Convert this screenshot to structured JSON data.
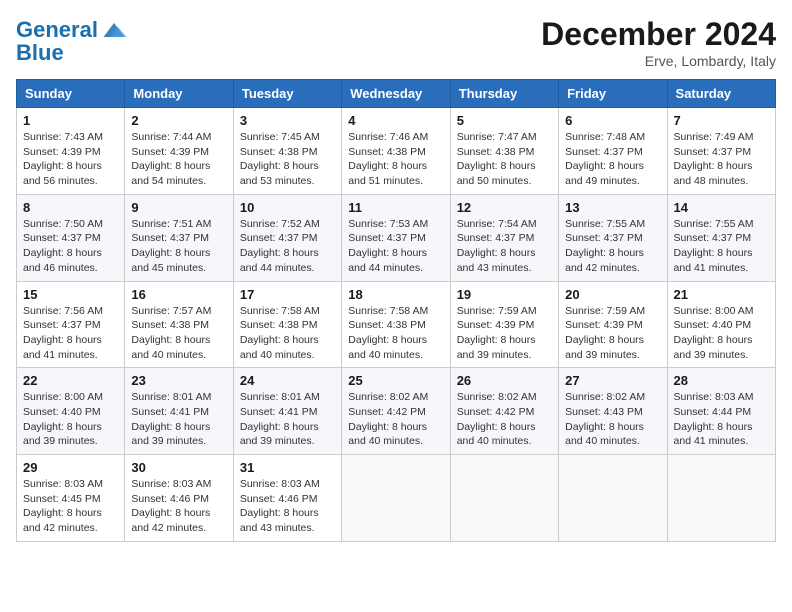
{
  "header": {
    "logo_line1": "General",
    "logo_line2": "Blue",
    "month_title": "December 2024",
    "subtitle": "Erve, Lombardy, Italy"
  },
  "weekdays": [
    "Sunday",
    "Monday",
    "Tuesday",
    "Wednesday",
    "Thursday",
    "Friday",
    "Saturday"
  ],
  "weeks": [
    [
      {
        "day": "1",
        "info": "Sunrise: 7:43 AM\nSunset: 4:39 PM\nDaylight: 8 hours\nand 56 minutes."
      },
      {
        "day": "2",
        "info": "Sunrise: 7:44 AM\nSunset: 4:39 PM\nDaylight: 8 hours\nand 54 minutes."
      },
      {
        "day": "3",
        "info": "Sunrise: 7:45 AM\nSunset: 4:38 PM\nDaylight: 8 hours\nand 53 minutes."
      },
      {
        "day": "4",
        "info": "Sunrise: 7:46 AM\nSunset: 4:38 PM\nDaylight: 8 hours\nand 51 minutes."
      },
      {
        "day": "5",
        "info": "Sunrise: 7:47 AM\nSunset: 4:38 PM\nDaylight: 8 hours\nand 50 minutes."
      },
      {
        "day": "6",
        "info": "Sunrise: 7:48 AM\nSunset: 4:37 PM\nDaylight: 8 hours\nand 49 minutes."
      },
      {
        "day": "7",
        "info": "Sunrise: 7:49 AM\nSunset: 4:37 PM\nDaylight: 8 hours\nand 48 minutes."
      }
    ],
    [
      {
        "day": "8",
        "info": "Sunrise: 7:50 AM\nSunset: 4:37 PM\nDaylight: 8 hours\nand 46 minutes."
      },
      {
        "day": "9",
        "info": "Sunrise: 7:51 AM\nSunset: 4:37 PM\nDaylight: 8 hours\nand 45 minutes."
      },
      {
        "day": "10",
        "info": "Sunrise: 7:52 AM\nSunset: 4:37 PM\nDaylight: 8 hours\nand 44 minutes."
      },
      {
        "day": "11",
        "info": "Sunrise: 7:53 AM\nSunset: 4:37 PM\nDaylight: 8 hours\nand 44 minutes."
      },
      {
        "day": "12",
        "info": "Sunrise: 7:54 AM\nSunset: 4:37 PM\nDaylight: 8 hours\nand 43 minutes."
      },
      {
        "day": "13",
        "info": "Sunrise: 7:55 AM\nSunset: 4:37 PM\nDaylight: 8 hours\nand 42 minutes."
      },
      {
        "day": "14",
        "info": "Sunrise: 7:55 AM\nSunset: 4:37 PM\nDaylight: 8 hours\nand 41 minutes."
      }
    ],
    [
      {
        "day": "15",
        "info": "Sunrise: 7:56 AM\nSunset: 4:37 PM\nDaylight: 8 hours\nand 41 minutes."
      },
      {
        "day": "16",
        "info": "Sunrise: 7:57 AM\nSunset: 4:38 PM\nDaylight: 8 hours\nand 40 minutes."
      },
      {
        "day": "17",
        "info": "Sunrise: 7:58 AM\nSunset: 4:38 PM\nDaylight: 8 hours\nand 40 minutes."
      },
      {
        "day": "18",
        "info": "Sunrise: 7:58 AM\nSunset: 4:38 PM\nDaylight: 8 hours\nand 40 minutes."
      },
      {
        "day": "19",
        "info": "Sunrise: 7:59 AM\nSunset: 4:39 PM\nDaylight: 8 hours\nand 39 minutes."
      },
      {
        "day": "20",
        "info": "Sunrise: 7:59 AM\nSunset: 4:39 PM\nDaylight: 8 hours\nand 39 minutes."
      },
      {
        "day": "21",
        "info": "Sunrise: 8:00 AM\nSunset: 4:40 PM\nDaylight: 8 hours\nand 39 minutes."
      }
    ],
    [
      {
        "day": "22",
        "info": "Sunrise: 8:00 AM\nSunset: 4:40 PM\nDaylight: 8 hours\nand 39 minutes."
      },
      {
        "day": "23",
        "info": "Sunrise: 8:01 AM\nSunset: 4:41 PM\nDaylight: 8 hours\nand 39 minutes."
      },
      {
        "day": "24",
        "info": "Sunrise: 8:01 AM\nSunset: 4:41 PM\nDaylight: 8 hours\nand 39 minutes."
      },
      {
        "day": "25",
        "info": "Sunrise: 8:02 AM\nSunset: 4:42 PM\nDaylight: 8 hours\nand 40 minutes."
      },
      {
        "day": "26",
        "info": "Sunrise: 8:02 AM\nSunset: 4:42 PM\nDaylight: 8 hours\nand 40 minutes."
      },
      {
        "day": "27",
        "info": "Sunrise: 8:02 AM\nSunset: 4:43 PM\nDaylight: 8 hours\nand 40 minutes."
      },
      {
        "day": "28",
        "info": "Sunrise: 8:03 AM\nSunset: 4:44 PM\nDaylight: 8 hours\nand 41 minutes."
      }
    ],
    [
      {
        "day": "29",
        "info": "Sunrise: 8:03 AM\nSunset: 4:45 PM\nDaylight: 8 hours\nand 42 minutes."
      },
      {
        "day": "30",
        "info": "Sunrise: 8:03 AM\nSunset: 4:46 PM\nDaylight: 8 hours\nand 42 minutes."
      },
      {
        "day": "31",
        "info": "Sunrise: 8:03 AM\nSunset: 4:46 PM\nDaylight: 8 hours\nand 43 minutes."
      },
      null,
      null,
      null,
      null
    ]
  ]
}
